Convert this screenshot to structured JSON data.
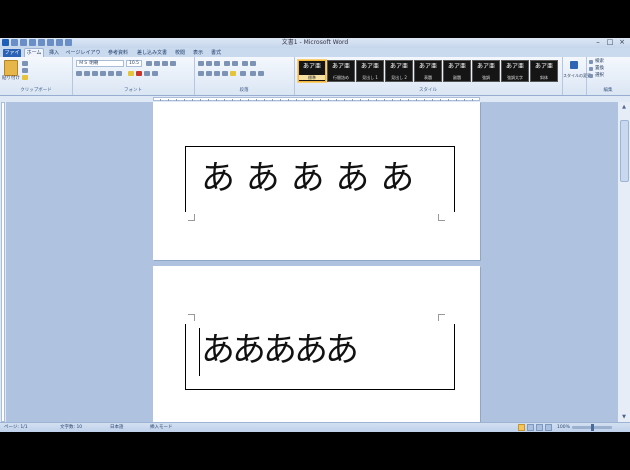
{
  "window": {
    "title": "文書1 - Microsoft Word",
    "controls": [
      "–",
      "□",
      "×"
    ]
  },
  "tabs": [
    "ファイル",
    "ホーム",
    "挿入",
    "ページレイアウト",
    "参考資料",
    "差し込み文書",
    "校閲",
    "表示",
    "書式"
  ],
  "ribbon": {
    "groups": [
      "クリップボード",
      "フォント",
      "段落",
      "スタイル",
      "編集"
    ],
    "paste_label": "貼り付け",
    "font_name": "ＭＳ 明朝",
    "font_size": "10.5",
    "styles": [
      {
        "sample": "あア亜",
        "name": "標準"
      },
      {
        "sample": "あア亜",
        "name": "行間詰め"
      },
      {
        "sample": "あア亜",
        "name": "見出し 1"
      },
      {
        "sample": "あア亜",
        "name": "見出し 2"
      },
      {
        "sample": "あア亜",
        "name": "表題"
      },
      {
        "sample": "あア亜",
        "name": "副題"
      },
      {
        "sample": "あア亜",
        "name": "強調"
      },
      {
        "sample": "あア亜",
        "name": "強調太字"
      },
      {
        "sample": "あア亜",
        "name": "斜体"
      }
    ],
    "change_styles_label": "スタイルの変更",
    "edit_items": [
      "検索",
      "置換",
      "選択"
    ]
  },
  "document": {
    "page1_text": "あ あ あ あ あ",
    "page2_text": "あああああ"
  },
  "status": {
    "page": "ページ: 1/1",
    "words": "文字数: 10",
    "language": "日本語",
    "mode": "挿入モード",
    "zoom": "100%"
  },
  "colors": {
    "file_tab": "#2b62b6",
    "style_gallery_bg": "#151515",
    "workspace": "#afc3e0"
  }
}
